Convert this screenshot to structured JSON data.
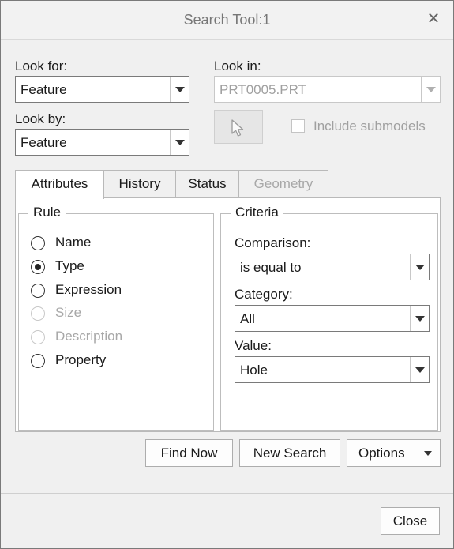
{
  "window": {
    "title": "Search Tool:1",
    "close_icon": "close-icon"
  },
  "look_for": {
    "label": "Look for:",
    "value": "Feature"
  },
  "look_by": {
    "label": "Look by:",
    "value": "Feature"
  },
  "look_in": {
    "label": "Look in:",
    "value": "PRT0005.PRT",
    "disabled": true
  },
  "pick_button": {
    "icon": "cursor-arrow-icon"
  },
  "include_submodels": {
    "label": "Include submodels",
    "checked": false,
    "disabled": true
  },
  "tabs": [
    {
      "label": "Attributes",
      "active": true,
      "disabled": false
    },
    {
      "label": "History",
      "active": false,
      "disabled": false
    },
    {
      "label": "Status",
      "active": false,
      "disabled": false
    },
    {
      "label": "Geometry",
      "active": false,
      "disabled": true
    }
  ],
  "rule": {
    "title": "Rule",
    "options": [
      {
        "label": "Name",
        "selected": false,
        "disabled": false
      },
      {
        "label": "Type",
        "selected": true,
        "disabled": false
      },
      {
        "label": "Expression",
        "selected": false,
        "disabled": false
      },
      {
        "label": "Size",
        "selected": false,
        "disabled": true
      },
      {
        "label": "Description",
        "selected": false,
        "disabled": true
      },
      {
        "label": "Property",
        "selected": false,
        "disabled": false
      }
    ]
  },
  "criteria": {
    "title": "Criteria",
    "comparison": {
      "label": "Comparison:",
      "value": "is equal to"
    },
    "category": {
      "label": "Category:",
      "value": "All"
    },
    "value": {
      "label": "Value:",
      "value": "Hole"
    }
  },
  "buttons": {
    "find_now": "Find Now",
    "new_search": "New Search",
    "options": "Options",
    "close": "Close"
  }
}
